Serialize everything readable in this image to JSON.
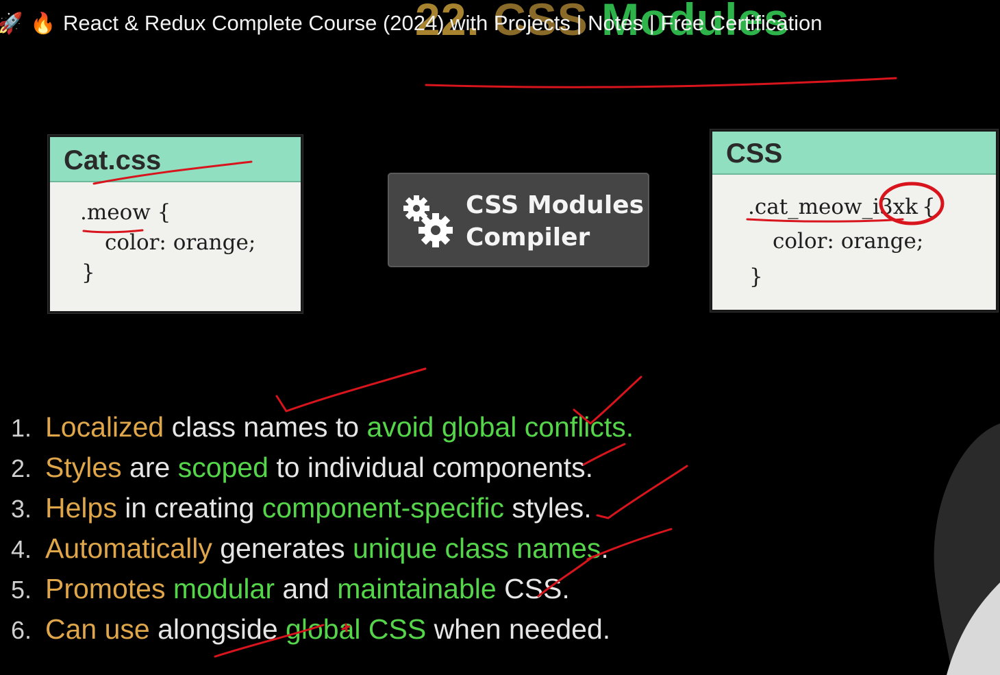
{
  "video": {
    "icons": [
      "rocket-emoji",
      "fire-emoji"
    ],
    "rocket": "🚀",
    "fire": "🔥",
    "title": "React & Redux Complete Course (2024) with Projects | Notes | Free Certification"
  },
  "slide": {
    "heading_number": "22.",
    "heading_css": "CSS",
    "heading_modules": "Modules",
    "source_card": {
      "title": "Cat.css",
      "line1": ".meow {",
      "line2": "color: orange;",
      "line3": "}"
    },
    "compiler": {
      "icon": "gears-icon",
      "label": "CSS Modules\nCompiler"
    },
    "output_card": {
      "title": "CSS",
      "line1_class": ".cat_meow_",
      "line1_hash": "i3xk",
      "line1_brace": "{",
      "line2": "color: orange;",
      "line3": "}"
    },
    "points": [
      {
        "num": "1.",
        "parts": [
          [
            "o",
            "Localized"
          ],
          [
            "w",
            " class names to "
          ],
          [
            "g",
            "avoid global conflicts."
          ]
        ]
      },
      {
        "num": "2.",
        "parts": [
          [
            "o",
            "Styles"
          ],
          [
            "w",
            " are "
          ],
          [
            "g",
            "scoped"
          ],
          [
            "w",
            " to individual components."
          ]
        ]
      },
      {
        "num": "3.",
        "parts": [
          [
            "o",
            "Helps"
          ],
          [
            "w",
            " in creating "
          ],
          [
            "g",
            "component-specific"
          ],
          [
            "w",
            " styles."
          ]
        ]
      },
      {
        "num": "4.",
        "parts": [
          [
            "o",
            "Automatically"
          ],
          [
            "w",
            " generates "
          ],
          [
            "g",
            "unique class names"
          ],
          [
            "w",
            "."
          ]
        ]
      },
      {
        "num": "5.",
        "parts": [
          [
            "o",
            "Promotes"
          ],
          [
            "w",
            " "
          ],
          [
            "g",
            "modular"
          ],
          [
            "w",
            " and "
          ],
          [
            "g",
            "maintainable"
          ],
          [
            "w",
            " CSS."
          ]
        ]
      },
      {
        "num": "6.",
        "parts": [
          [
            "o",
            "Can use"
          ],
          [
            "w",
            " alongside "
          ],
          [
            "g",
            "global CSS"
          ],
          [
            "w",
            " when needed."
          ]
        ]
      }
    ],
    "colors": {
      "highlight_orange": "#e0a64a",
      "highlight_green": "#55d64a",
      "card_header": "#8fdfc0",
      "annotation_red": "#d8141c"
    }
  }
}
